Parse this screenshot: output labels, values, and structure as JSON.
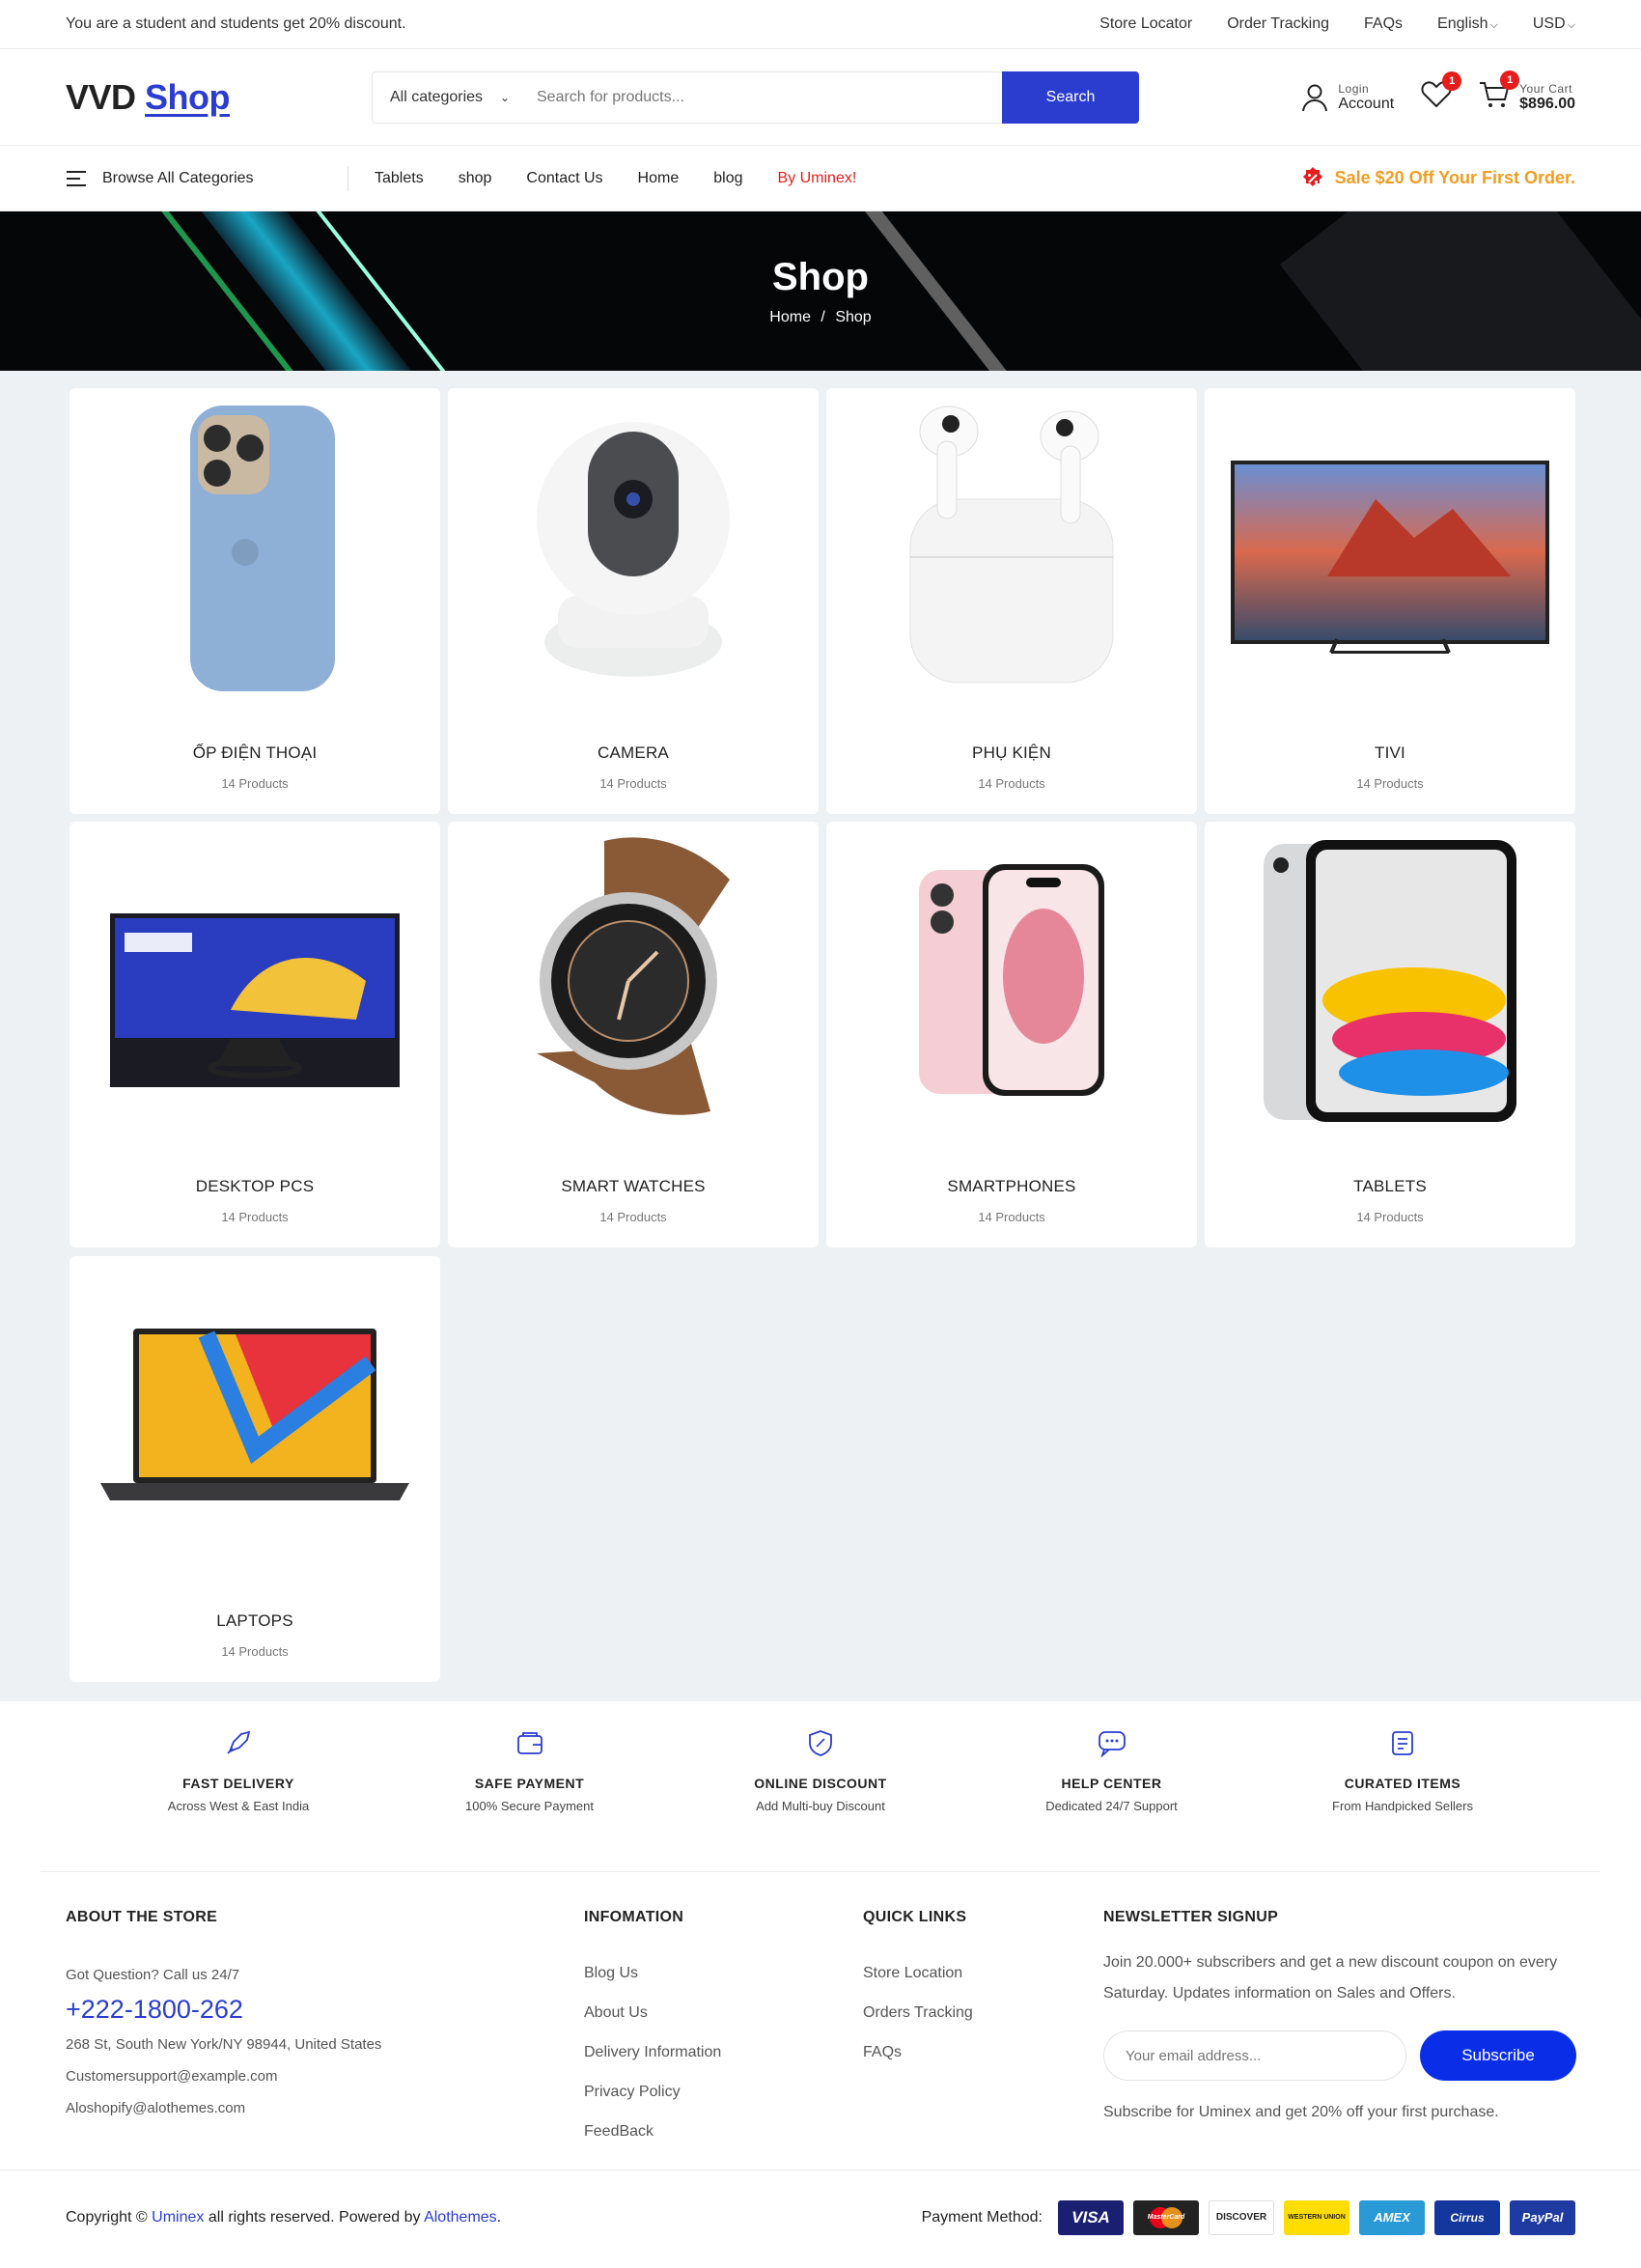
{
  "topbar": {
    "promo": "You are a student and students get 20% discount.",
    "links": [
      "Store Locator",
      "Order Tracking",
      "FAQs"
    ],
    "language": "English",
    "currency": "USD"
  },
  "header": {
    "logo_main": "VVD",
    "logo_accent": "Shop",
    "category_select": "All categories",
    "search_placeholder": "Search for products...",
    "search_button": "Search",
    "account_small": "Login",
    "account_label": "Account",
    "wishlist_count": "1",
    "cart_count": "1",
    "cart_small": "Your Cart",
    "cart_total": "$896.00"
  },
  "nav": {
    "browse": "Browse All Categories",
    "links": [
      "Tablets",
      "shop",
      "Contact Us",
      "Home",
      "blog"
    ],
    "highlight": "By Uminex!",
    "sale": "Sale $20 Off Your First Order."
  },
  "hero": {
    "title": "Shop",
    "crumb_home": "Home",
    "crumb_sep": "/",
    "crumb_current": "Shop"
  },
  "categories": [
    {
      "name": "ỐP ĐIỆN THOẠI",
      "count": "14 Products",
      "icon": "phone-case"
    },
    {
      "name": "CAMERA",
      "count": "14 Products",
      "icon": "security-camera"
    },
    {
      "name": "PHỤ KIỆN",
      "count": "14 Products",
      "icon": "earbuds"
    },
    {
      "name": "TIVI",
      "count": "14 Products",
      "icon": "television"
    },
    {
      "name": "DESKTOP PCS",
      "count": "14 Products",
      "icon": "monitor"
    },
    {
      "name": "SMART WATCHES",
      "count": "14 Products",
      "icon": "smartwatch"
    },
    {
      "name": "SMARTPHONES",
      "count": "14 Products",
      "icon": "smartphone"
    },
    {
      "name": "TABLETS",
      "count": "14 Products",
      "icon": "tablet"
    },
    {
      "name": "LAPTOPS",
      "count": "14 Products",
      "icon": "laptop"
    }
  ],
  "features": [
    {
      "title": "FAST DELIVERY",
      "sub": "Across West & East India",
      "icon": "rocket-icon"
    },
    {
      "title": "SAFE PAYMENT",
      "sub": "100% Secure Payment",
      "icon": "wallet-icon"
    },
    {
      "title": "ONLINE DISCOUNT",
      "sub": "Add Multi-buy Discount",
      "icon": "discount-shield-icon"
    },
    {
      "title": "HELP CENTER",
      "sub": "Dedicated 24/7 Support",
      "icon": "chat-icon"
    },
    {
      "title": "CURATED ITEMS",
      "sub": "From Handpicked Sellers",
      "icon": "list-icon"
    }
  ],
  "footer": {
    "about": {
      "title": "ABOUT THE STORE",
      "question": "Got Question? Call us 24/7",
      "phone": "+222-1800-262",
      "address": "268 St, South New York/NY 98944, United States",
      "email1": "Customersupport@example.com",
      "email2": "Aloshopify@alothemes.com"
    },
    "info": {
      "title": "INFOMATION",
      "links": [
        "Blog Us",
        "About Us",
        "Delivery Information",
        "Privacy Policy",
        "FeedBack"
      ]
    },
    "quick": {
      "title": "QUICK LINKS",
      "links": [
        "Store Location",
        "Orders Tracking",
        "FAQs"
      ]
    },
    "newsletter": {
      "title": "NEWSLETTER SIGNUP",
      "text": "Join 20.000+ subscribers and get a new discount coupon on every Saturday. Updates information on Sales and Offers.",
      "placeholder": "Your email address...",
      "button": "Subscribe",
      "note": "Subscribe for Uminex and get 20% off your first purchase."
    }
  },
  "bottom": {
    "copy_prefix": "Copyright ©",
    "brand": "Uminex",
    "copy_mid": "all rights reserved. Powered by",
    "powered": "Alothemes",
    "copy_end": ".",
    "payment_label": "Payment Method:",
    "payments": [
      "VISA",
      "MasterCard",
      "DISCOVER",
      "WESTERN UNION",
      "AMEX",
      "Cirrus",
      "PayPal"
    ]
  },
  "colors": {
    "accent": "#2b3dcf",
    "sale": "#f29d21",
    "badge": "#e51d1d",
    "grid_bg": "#eef1f4"
  }
}
